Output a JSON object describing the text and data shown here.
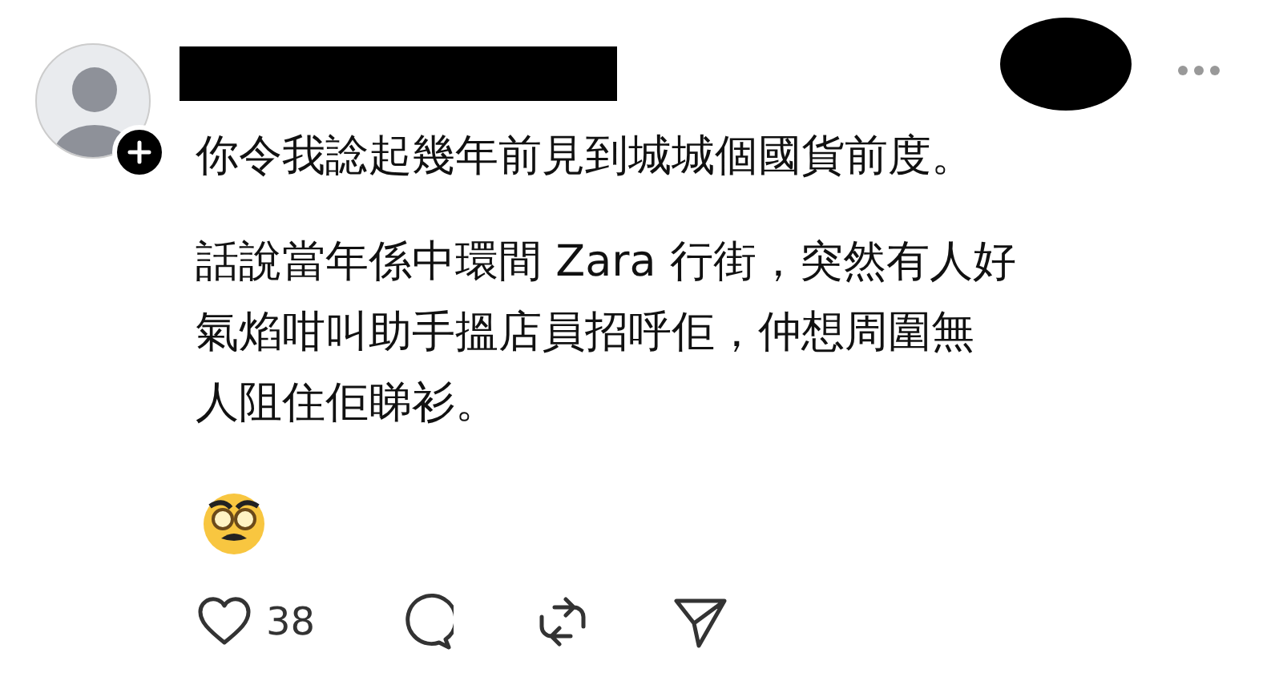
{
  "post": {
    "text_lines": [
      "你令我諗起幾年前見到城城個國貨前度。"
    ],
    "paragraph_lines": [
      "話說當年係中環間 Zara 行街，突然有人好",
      "氣焰咁叫助手搵店員招呼佢，仲想周圍無",
      "人阻住佢睇衫。"
    ],
    "like_count": "38"
  }
}
